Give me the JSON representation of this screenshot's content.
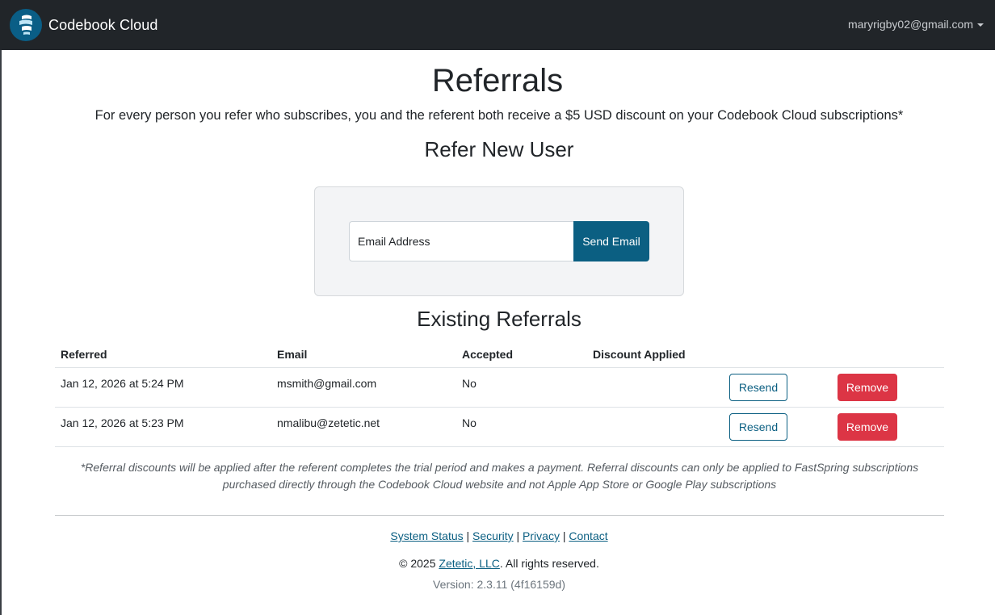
{
  "navbar": {
    "brand": "Codebook Cloud",
    "user_email": "maryrigby02@gmail.com",
    "logo_icon": "codebook-logo-icon",
    "caret_icon": "chevron-down-icon"
  },
  "page": {
    "title": "Referrals",
    "intro": "For every person you refer who subscribes, you and the referent both receive a $5 USD discount on your Codebook Cloud subscriptions*"
  },
  "refer_section": {
    "heading": "Refer New User",
    "email_placeholder": "Email Address",
    "send_label": "Send Email"
  },
  "existing_section": {
    "heading": "Existing Referrals",
    "columns": {
      "referred": "Referred",
      "email": "Email",
      "accepted": "Accepted",
      "discount": "Discount Applied"
    },
    "rows": [
      {
        "referred": "Jan 12, 2026 at 5:24 PM",
        "email": "msmith@gmail.com",
        "accepted": "No",
        "discount": "",
        "resend_label": "Resend",
        "remove_label": "Remove"
      },
      {
        "referred": "Jan 12, 2026 at 5:23 PM",
        "email": "nmalibu@zetetic.net",
        "accepted": "No",
        "discount": "",
        "resend_label": "Resend",
        "remove_label": "Remove"
      }
    ],
    "footnote_line1": "*Referral discounts will be applied after the referent completes the trial period and makes a payment. Referral discounts can only be applied to FastSpring subscriptions",
    "footnote_line2": "purchased directly through the Codebook Cloud website and not Apple App Store or Google Play subscriptions"
  },
  "footer": {
    "links": {
      "system_status": "System Status",
      "security": "Security",
      "privacy": "Privacy",
      "contact": "Contact",
      "separator": "|"
    },
    "copyright_prefix": "© 2025",
    "company": "Zetetic, LLC",
    "copyright_suffix": ". All rights reserved.",
    "version": "Version: 2.3.11 (4f16159d)"
  },
  "colors": {
    "navbar_bg": "#212529",
    "primary": "#0b5f82",
    "danger": "#dc3545",
    "card_bg": "#f3f4f6"
  }
}
